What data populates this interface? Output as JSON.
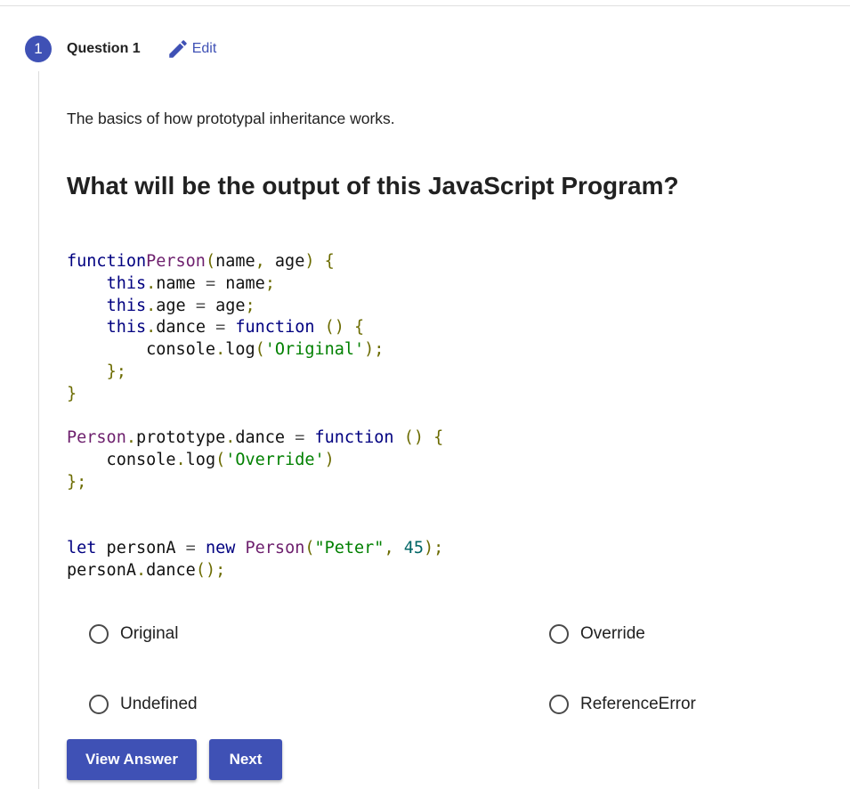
{
  "step": {
    "number": "1",
    "title": "Question 1",
    "edit_label": "Edit"
  },
  "intro_text": "The basics of how prototypal inheritance works.",
  "question_text": "What will be the output of this JavaScript Program?",
  "code_lines": [
    [
      [
        "kw",
        "function"
      ],
      [
        "",
        "",
        " "
      ],
      [
        "fn",
        "Person"
      ],
      [
        "pn",
        "("
      ],
      [
        "",
        "name"
      ],
      [
        "pn",
        ","
      ],
      [
        "",
        " age"
      ],
      [
        "pn",
        ")"
      ],
      [
        "",
        " "
      ],
      [
        "pn",
        "{"
      ]
    ],
    [
      [
        "",
        "    "
      ],
      [
        "kw",
        "this"
      ],
      [
        "pn",
        "."
      ],
      [
        "",
        "name "
      ],
      [
        "op",
        "="
      ],
      [
        "",
        " name"
      ],
      [
        "pn",
        ";"
      ]
    ],
    [
      [
        "",
        "    "
      ],
      [
        "kw",
        "this"
      ],
      [
        "pn",
        "."
      ],
      [
        "",
        "age "
      ],
      [
        "op",
        "="
      ],
      [
        "",
        " age"
      ],
      [
        "pn",
        ";"
      ]
    ],
    [
      [
        "",
        "    "
      ],
      [
        "kw",
        "this"
      ],
      [
        "pn",
        "."
      ],
      [
        "",
        "dance "
      ],
      [
        "op",
        "="
      ],
      [
        "",
        " "
      ],
      [
        "kw",
        "function"
      ],
      [
        "",
        " "
      ],
      [
        "pn",
        "()"
      ],
      [
        "",
        " "
      ],
      [
        "pn",
        "{"
      ]
    ],
    [
      [
        "",
        "        console"
      ],
      [
        "pn",
        "."
      ],
      [
        "",
        "log"
      ],
      [
        "pn",
        "("
      ],
      [
        "str",
        "'Original'"
      ],
      [
        "pn",
        ");"
      ]
    ],
    [
      [
        "",
        "    "
      ],
      [
        "pn",
        "};"
      ]
    ],
    [
      [
        "pn",
        "}"
      ]
    ],
    [],
    [
      [
        "fn",
        "Person"
      ],
      [
        "pn",
        "."
      ],
      [
        "",
        "prototype"
      ],
      [
        "pn",
        "."
      ],
      [
        "",
        "dance "
      ],
      [
        "op",
        "="
      ],
      [
        "",
        " "
      ],
      [
        "kw",
        "function"
      ],
      [
        "",
        " "
      ],
      [
        "pn",
        "()"
      ],
      [
        "",
        " "
      ],
      [
        "pn",
        "{"
      ]
    ],
    [
      [
        "",
        "    console"
      ],
      [
        "pn",
        "."
      ],
      [
        "",
        "log"
      ],
      [
        "pn",
        "("
      ],
      [
        "str",
        "'Override'"
      ],
      [
        "pn",
        ")"
      ]
    ],
    [
      [
        "pn",
        "};"
      ]
    ],
    [],
    [],
    [
      [
        "kw",
        "let"
      ],
      [
        "",
        " personA "
      ],
      [
        "op",
        "="
      ],
      [
        "",
        " "
      ],
      [
        "kw",
        "new"
      ],
      [
        "",
        " "
      ],
      [
        "fn",
        "Person"
      ],
      [
        "pn",
        "("
      ],
      [
        "str",
        "\"Peter\""
      ],
      [
        "pn",
        ","
      ],
      [
        "",
        " "
      ],
      [
        "num",
        "45"
      ],
      [
        "pn",
        ");"
      ]
    ],
    [
      [
        "",
        "personA"
      ],
      [
        "pn",
        "."
      ],
      [
        "",
        "dance"
      ],
      [
        "pn",
        "();"
      ]
    ]
  ],
  "options": {
    "a": "Original",
    "b": "Override",
    "c": "Undefined",
    "d": "ReferenceError"
  },
  "buttons": {
    "view_answer": "View Answer",
    "next": "Next"
  },
  "colors": {
    "accent": "#3f51b5"
  },
  "icons": {
    "edit": "pencil-icon",
    "option": "radio-unchecked-icon"
  }
}
